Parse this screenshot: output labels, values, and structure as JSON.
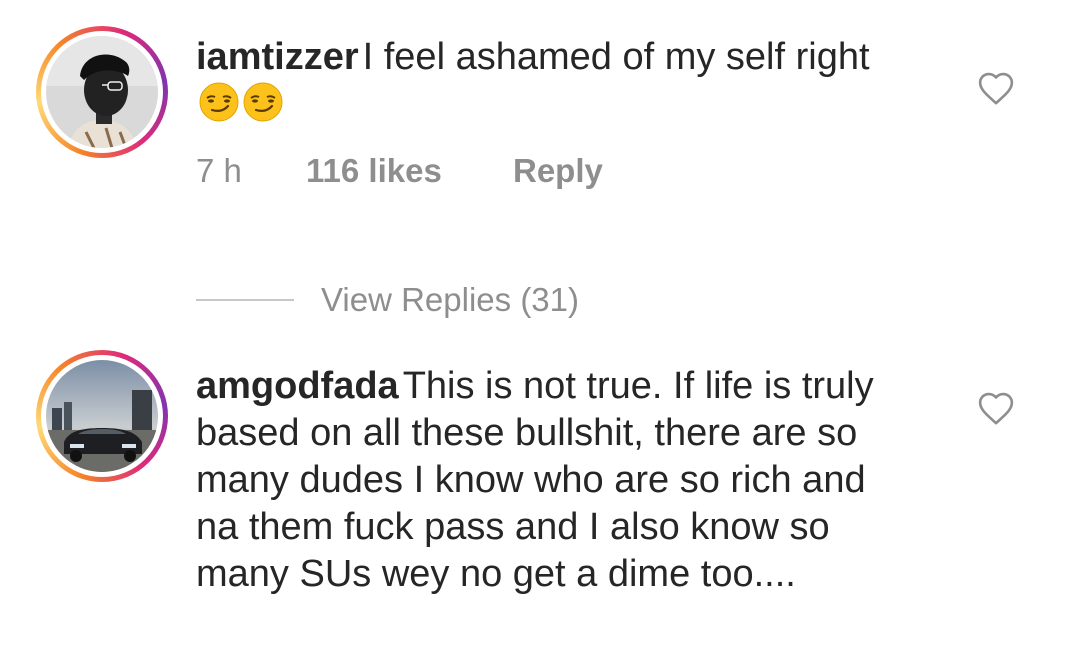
{
  "comments": [
    {
      "username": "iamtizzer",
      "text": "I feel ashamed of my self right",
      "emojis": [
        "smirking-face-emoji",
        "smirking-face-emoji"
      ],
      "time": "7 h",
      "likes": "116 likes",
      "reply_label": "Reply",
      "view_replies": "View Replies (31)"
    },
    {
      "username": "amgodfada",
      "text": "This is not true. If life is truly based on all these bullshit, there are so many dudes I know who are so rich and na them fuck pass and I also know so many SUs wey no get a dime too...."
    }
  ],
  "icons": {
    "like": "heart-outline-icon"
  },
  "colors": {
    "text": "#262626",
    "secondary_text": "#8e8e8e",
    "divider": "#c7c7c7",
    "story_ring_start": "#f58529",
    "story_ring_end": "#dd2a7b"
  }
}
